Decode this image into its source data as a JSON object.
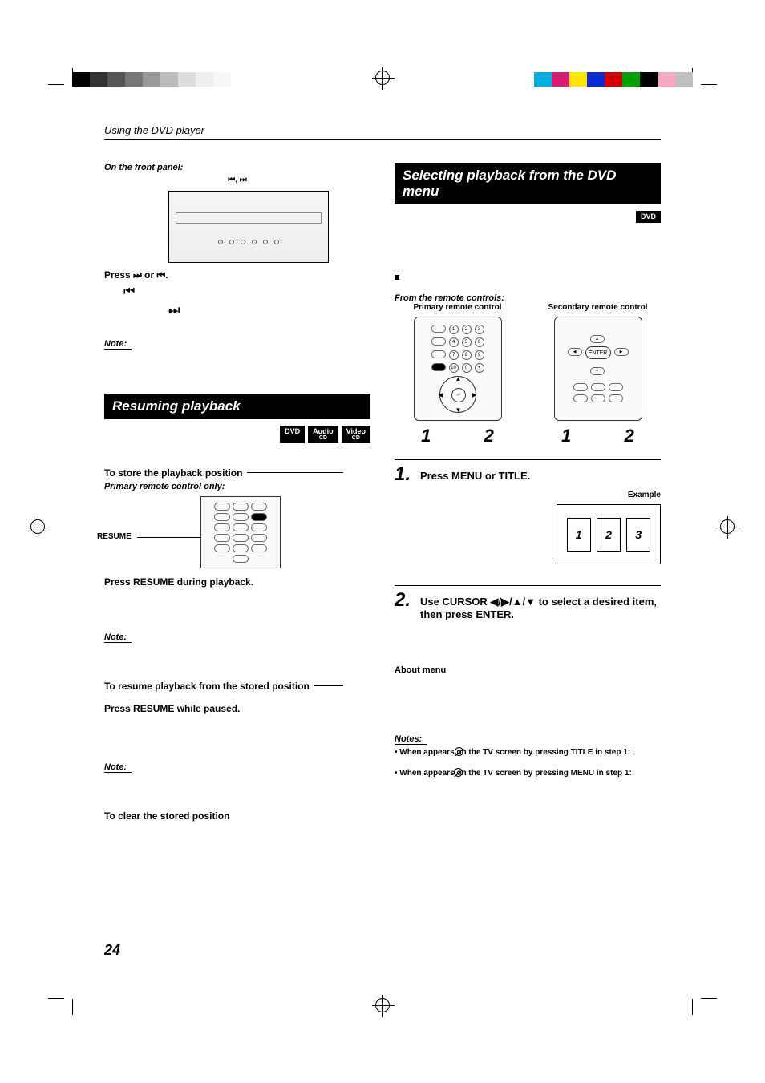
{
  "header": "Using the DVD player",
  "page_number": "24",
  "left": {
    "on_front_panel": "On the front panel:",
    "skip_caption": "⏮, ⏭",
    "press_skip": "Press ⏭ or ⏮.",
    "skip_back_sym": "⏮",
    "skip_fwd_sym": "⏭",
    "note": "Note:",
    "section_resume": "Resuming playback",
    "badge_dvd": "DVD",
    "badge_audio_top": "Audio",
    "badge_audio_bot": "CD",
    "badge_video_top": "Video",
    "badge_video_bot": "CD",
    "store_heading": "To store the playback position",
    "primary_only": "Primary remote control only:",
    "resume_label": "RESUME",
    "press_resume_playback": "Press RESUME during playback.",
    "resume_heading": "To resume playback from the stored position",
    "press_resume_paused": "Press RESUME while paused.",
    "clear_heading": "To clear the stored position"
  },
  "right": {
    "section_select": "Selecting playback from the DVD menu",
    "badge_dvd": "DVD",
    "bullet": "■",
    "from_remotes": "From the remote controls:",
    "primary_label": "Primary remote control",
    "secondary_label": "Secondary remote control",
    "enter_btn": "ENTER",
    "num1": "1",
    "num2": "2",
    "step1_num": "1.",
    "step1_text": "Press MENU or TITLE.",
    "example_label": "Example",
    "thumb1": "1",
    "thumb2": "2",
    "thumb3": "3",
    "step2_num": "2.",
    "step2_text": "Use CURSOR ◀/▶/▲/▼ to select a desired item, then press ENTER.",
    "about_menu": "About menu",
    "notes_hd": "Notes:",
    "note_title": "When       appears on the TV screen by pressing TITLE in step 1:",
    "note_menu": "When       appears on the TV screen by pressing MENU in step 1:"
  }
}
